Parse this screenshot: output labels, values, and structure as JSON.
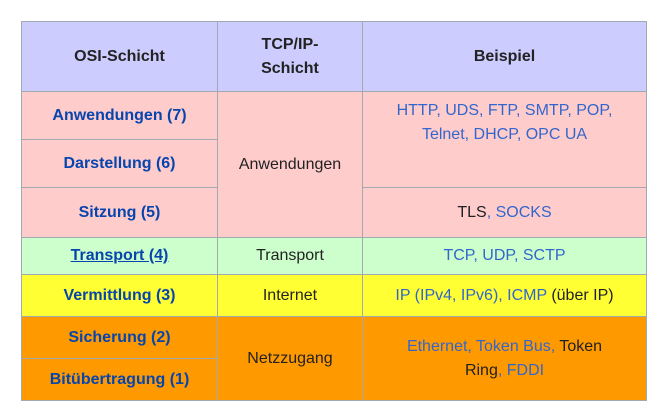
{
  "header": {
    "osi": "OSI-Schicht",
    "tcpip": "TCP/IP-\nSchicht",
    "tcpip_line1": "TCP/IP-",
    "tcpip_line2": "Schicht",
    "example": "Beispiel"
  },
  "rows": {
    "anwendung": {
      "name": "Anwendungen (7)"
    },
    "darstellung": {
      "name": "Darstellung (6)"
    },
    "sitzung": {
      "name": "Sitzung (5)"
    },
    "transport": {
      "name": "Transport (4)",
      "name_link": "Transport",
      "name_num": " (4)"
    },
    "vermittlung": {
      "name": "Vermittlung (3)"
    },
    "sicherung": {
      "name": "Sicherung (2)"
    },
    "bituebertragung": {
      "name": "Bitübertragung (1)"
    }
  },
  "tcpip": {
    "anwendungen": "Anwendungen",
    "transport": "Transport",
    "internet": "Internet",
    "netzzugang": "Netzzugang"
  },
  "examples": {
    "app_top": {
      "http": "HTTP",
      "uds": "UDS",
      "ftp": "FTP",
      "smtp": "SMTP",
      "pop": "POP",
      "telnet": "Telnet",
      "dhcp": "DHCP",
      "opcua": "OPC UA"
    },
    "app_bottom": {
      "tls": "TLS",
      "socks": "SOCKS"
    },
    "transport": {
      "tcp": "TCP",
      "udp": "UDP",
      "sctp": "SCTP"
    },
    "internet": {
      "ip": "IP",
      "ipv4": "IPv4",
      "ipv6": "IPv6",
      "icmp": "ICMP",
      "ueber_ip": "(über IP)"
    },
    "link": {
      "ethernet": "Ethernet",
      "tokenbus": "Token Bus",
      "tokenring_1": "Token",
      "tokenring_2": "Ring",
      "fddi": "FDDI"
    }
  },
  "colors": {
    "header_bg": "#ccccff",
    "application_bg": "#ffcccc",
    "transport_bg": "#ccffcc",
    "internet_bg": "#ffff33",
    "link_bg": "#ff9900",
    "link_text": "#3366cc",
    "layer_text": "#0645ad"
  }
}
